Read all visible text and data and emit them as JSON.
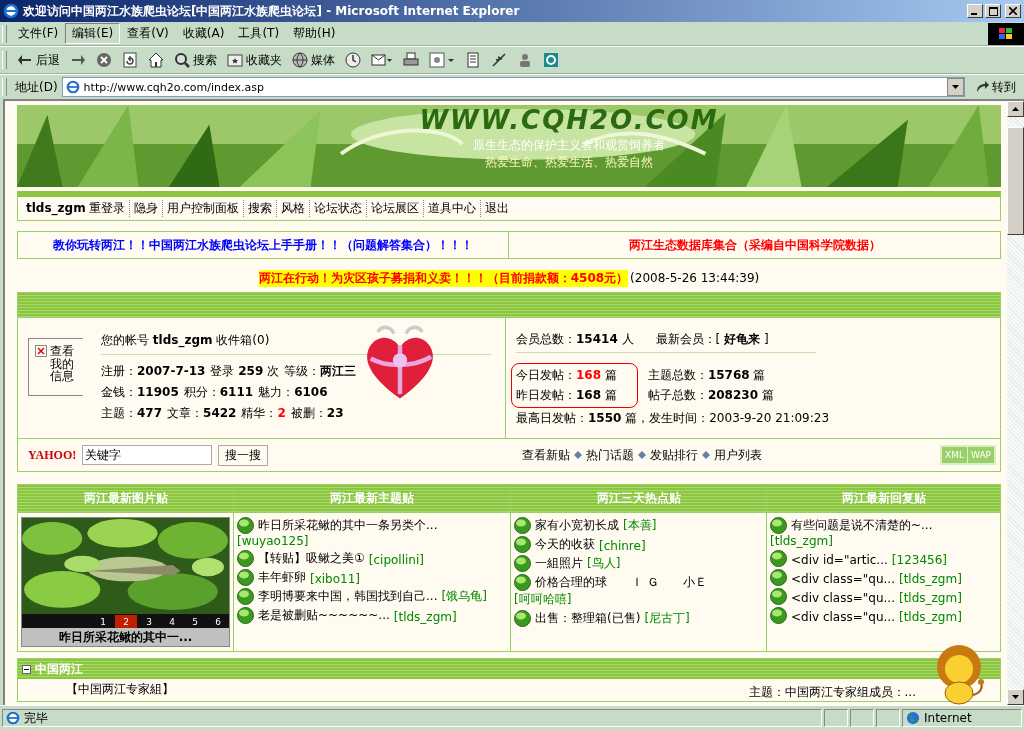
{
  "window": {
    "title": "欢迎访问中国两江水族爬虫论坛[中国两江水族爬虫论坛] - Microsoft Internet Explorer"
  },
  "menu": [
    {
      "label": "文件(F)",
      "selected": false
    },
    {
      "label": "编辑(E)",
      "selected": true
    },
    {
      "label": "查看(V)",
      "selected": false
    },
    {
      "label": "收藏(A)",
      "selected": false
    },
    {
      "label": "工具(T)",
      "selected": false
    },
    {
      "label": "帮助(H)",
      "selected": false
    }
  ],
  "toolbar": [
    {
      "kind": "back",
      "label": "后退"
    },
    {
      "kind": "forward"
    },
    {
      "kind": "stop"
    },
    {
      "kind": "refresh"
    },
    {
      "kind": "home"
    },
    {
      "kind": "search",
      "label": "搜索"
    },
    {
      "kind": "favorites",
      "label": "收藏夹"
    },
    {
      "kind": "media",
      "label": "媒体"
    },
    {
      "kind": "history"
    },
    {
      "kind": "mail"
    },
    {
      "kind": "print"
    },
    {
      "kind": "discuss"
    },
    {
      "kind": "edit"
    },
    {
      "kind": "research"
    },
    {
      "kind": "messenger"
    },
    {
      "kind": "app"
    }
  ],
  "address": {
    "label": "地址(D)",
    "url": "http://www.cqh2o.com/index.asp",
    "go": "转到"
  },
  "banner": {
    "site": "WWW.CQH2O.COM",
    "slogan_1": "原生生态的保护主义者和观赏饲养者",
    "slogan_2": "热爱生命、热爱生活、热爱自然"
  },
  "nav": {
    "user": "tlds_zgm",
    "first": "重登录",
    "links": [
      "隐身",
      "用户控制面板",
      "搜索",
      "风格",
      "论坛状态",
      "论坛展区",
      "道具中心",
      "退出"
    ]
  },
  "notices": [
    {
      "text": "教你玩转两江！！中国两江水族爬虫论坛上手手册！！（问题解答集合）！！！",
      "color": "#0000ff"
    },
    {
      "text": "两江生态数据库集合（采编自中国科学院数据）",
      "color": "#ff0000"
    }
  ],
  "donation": {
    "text": "两江在行动！为灾区孩子募捐和义卖！！！（目前捐款额：4508元）",
    "time": "(2008-5-26 13:44:39)"
  },
  "user_panel": {
    "avatar_label": "查看我的信息",
    "account": "您的帐号 **tlds_zgm** 收件箱(0)",
    "lines": [
      [
        {
          "text": "注册：**2007-7-13**",
          "highlight": false
        },
        {
          "text": "登录 **259** 次",
          "highlight": false
        },
        {
          "text": "等级：**两江三**",
          "highlight": false
        }
      ],
      [
        {
          "text": "金钱：**11905**",
          "highlight": false
        },
        {
          "text": "积分：**6111**",
          "highlight": false
        },
        {
          "text": "魅力：**6106**",
          "highlight": false
        }
      ],
      [
        {
          "text": "主题：**477**",
          "highlight": false
        },
        {
          "text": "文章：**5422**",
          "highlight": false
        },
        {
          "text": "精华：**2**",
          "highlight": true
        },
        {
          "text": "被删：**23**",
          "highlight": false
        }
      ]
    ]
  },
  "stats": {
    "top": [
      {
        "text": "会员总数：**15414** 人",
        "highlight": false
      },
      {
        "text": "最新会员：[ **好龟来** ]",
        "highlight": false
      }
    ],
    "daily": [
      {
        "text": "今日发帖：**168** 篇",
        "highlight": true
      },
      {
        "text": "昨日发帖：**168** 篇",
        "highlight": false
      }
    ],
    "totals": [
      {
        "text": "主题总数：**15768** 篇",
        "highlight": false
      },
      {
        "text": "帖子总数：**208230** 篇",
        "highlight": false
      }
    ],
    "record": {
      "text": "最高日发帖：**1550** 篇，发生时间：2003-9-20 21:09:23",
      "highlight": false
    }
  },
  "search": {
    "logo": "YAHOO!",
    "value": "关键字",
    "button": "搜一搜",
    "links": [
      "查看新贴",
      "热门话题",
      "发贴排行",
      "用户列表"
    ],
    "badges": [
      "XML",
      "WAP"
    ]
  },
  "columns": [
    {
      "title": "两江最新图片贴",
      "kind": "gallery",
      "caption": "昨日所采花鳅的其中一...",
      "pages": [
        {
          "label": "1",
          "selected": false
        },
        {
          "label": "2",
          "selected": true
        },
        {
          "label": "3",
          "selected": false
        },
        {
          "label": "4",
          "selected": false
        },
        {
          "label": "5",
          "selected": false
        },
        {
          "label": "6",
          "selected": false
        }
      ]
    },
    {
      "title": "两江最新主题贴",
      "kind": "posts",
      "posts": [
        {
          "title": "昨日所采花鳅的其中一条另类个...",
          "author": "[wuyao125]"
        },
        {
          "title": "【转贴】吸鳅之美①",
          "author": "[cipollini]"
        },
        {
          "title": "丰年虾卵",
          "author": "[xibo11]"
        },
        {
          "title": "李明博要来中国，韩国找到自己...",
          "author": "[饿乌龟]"
        },
        {
          "title": "老是被删贴~~~~~~...",
          "author": "[tlds_zgm]"
        }
      ]
    },
    {
      "title": "两江三天热点贴",
      "kind": "posts",
      "posts": [
        {
          "title": "家有小宽初长成",
          "author": "[本善]"
        },
        {
          "title": "今天的收获",
          "author": "[chinre]"
        },
        {
          "title": "一組照片",
          "author": "[鸟人]"
        },
        {
          "title": "价格合理的球　　Ｉ Ｇ　　小Ｅ",
          "author": "[呵呵哈嘻]"
        },
        {
          "title": "出售：整理箱(已售)",
          "author": "[尼古丁]"
        }
      ]
    },
    {
      "title": "两江最新回复贴",
      "kind": "posts",
      "posts": [
        {
          "title": "有些问题是说不清楚的~...",
          "author": "[tlds_zgm]"
        },
        {
          "title": "<div id=\"artic...",
          "author": "[123456]"
        },
        {
          "title": "<div class=\"qu...",
          "author": "[tlds_zgm]"
        },
        {
          "title": "<div class=\"qu...",
          "author": "[tlds_zgm]"
        },
        {
          "title": "<div class=\"qu...",
          "author": "[tlds_zgm]"
        }
      ]
    }
  ],
  "section": {
    "title": "中国两江",
    "expanded": true,
    "forum": "【中国两江专家組】",
    "latest": "主题：中国两江专家组成员：..."
  },
  "status_bar": {
    "text": "完毕",
    "zone": "Internet"
  }
}
